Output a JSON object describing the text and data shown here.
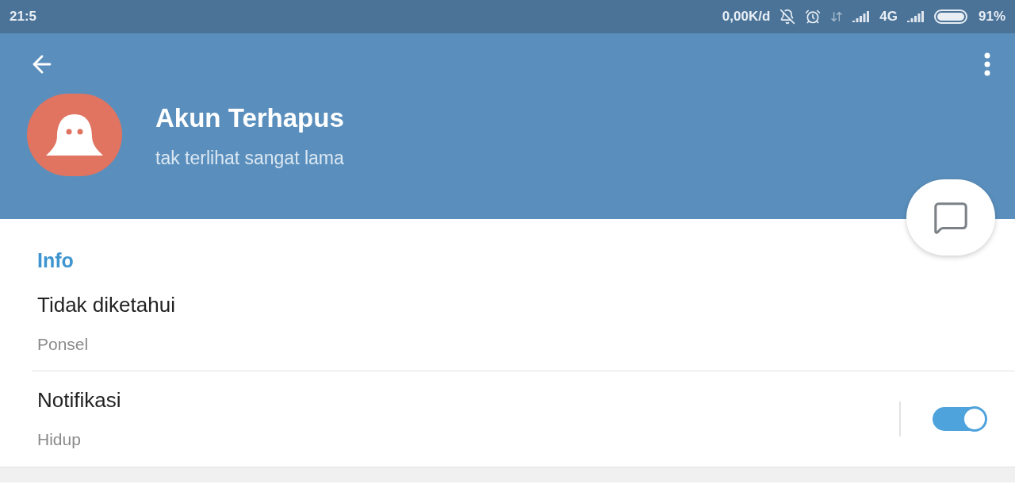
{
  "status_bar": {
    "time": "21:5",
    "speed": "0,00K/d",
    "network": "4G",
    "battery": "91%"
  },
  "profile": {
    "name": "Akun Terhapus",
    "last_seen": "tak terlihat sangat lama"
  },
  "info": {
    "heading": "Info",
    "rows": [
      {
        "kind": "text",
        "title": "Tidak diketahui",
        "subtitle": "Ponsel"
      },
      {
        "kind": "toggle",
        "title": "Notifikasi",
        "subtitle": "Hidup",
        "on": true
      }
    ]
  }
}
